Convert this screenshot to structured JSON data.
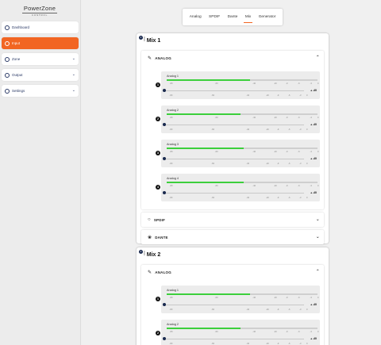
{
  "brand": {
    "name": "PowerZone",
    "sub": "CONTROL"
  },
  "sidebar": {
    "items": [
      {
        "label": "Dashboard",
        "icon": "dashboard-icon",
        "active": false,
        "expandable": false
      },
      {
        "label": "Input",
        "icon": "input-icon",
        "active": true,
        "expandable": false
      },
      {
        "label": "Zone",
        "icon": "zone-icon",
        "active": false,
        "expandable": true
      },
      {
        "label": "Output",
        "icon": "output-icon",
        "active": false,
        "expandable": true
      },
      {
        "label": "Settings",
        "icon": "settings-icon",
        "active": false,
        "expandable": true
      }
    ]
  },
  "tabs": [
    {
      "label": "Analog",
      "active": false
    },
    {
      "label": "SPDIF",
      "active": false
    },
    {
      "label": "Dante",
      "active": false
    },
    {
      "label": "Mix",
      "active": true
    },
    {
      "label": "Generator",
      "active": false
    }
  ],
  "meter_ticks": [
    "-80",
    "-60",
    "-40",
    "-20",
    "-9",
    "-6",
    "-3",
    "0"
  ],
  "fader_ticks": [
    "-80",
    "-60",
    "-40",
    "-20",
    "-9",
    "-6",
    "-3",
    "0"
  ],
  "mixes": [
    {
      "badge": "1",
      "title": "Mix 1",
      "sections": [
        {
          "label": "ANALOG",
          "icon": "pen-icon",
          "expanded": true,
          "channels": [
            {
              "num": "1",
              "label": "Analog 1",
              "level": 0.55,
              "value": "-40",
              "fader": 0.0
            },
            {
              "num": "2",
              "label": "Analog 2",
              "level": 0.49,
              "value": "-40",
              "fader": 0.0
            },
            {
              "num": "3",
              "label": "Analog 3",
              "level": 0.51,
              "value": "-40",
              "fader": 0.0
            },
            {
              "num": "4",
              "label": "Analog 4",
              "level": 0.51,
              "value": "-40",
              "fader": 0.0
            }
          ]
        },
        {
          "label": "SPDIF",
          "icon": "circle-icon",
          "expanded": false
        },
        {
          "label": "DANTE",
          "icon": "dante-icon",
          "expanded": false
        }
      ]
    },
    {
      "badge": "2",
      "title": "Mix 2",
      "sections": [
        {
          "label": "ANALOG",
          "icon": "pen-icon",
          "expanded": true,
          "channels": [
            {
              "num": "1",
              "label": "Analog 1",
              "level": 0.55,
              "value": "-40",
              "fader": 0.0
            },
            {
              "num": "2",
              "label": "Analog 2",
              "level": 0.49,
              "value": "-40",
              "fader": 0.0
            }
          ]
        }
      ]
    }
  ],
  "colors": {
    "accent": "#f26522",
    "navy": "#1a2a4f",
    "meter": "#3ccf3c"
  }
}
